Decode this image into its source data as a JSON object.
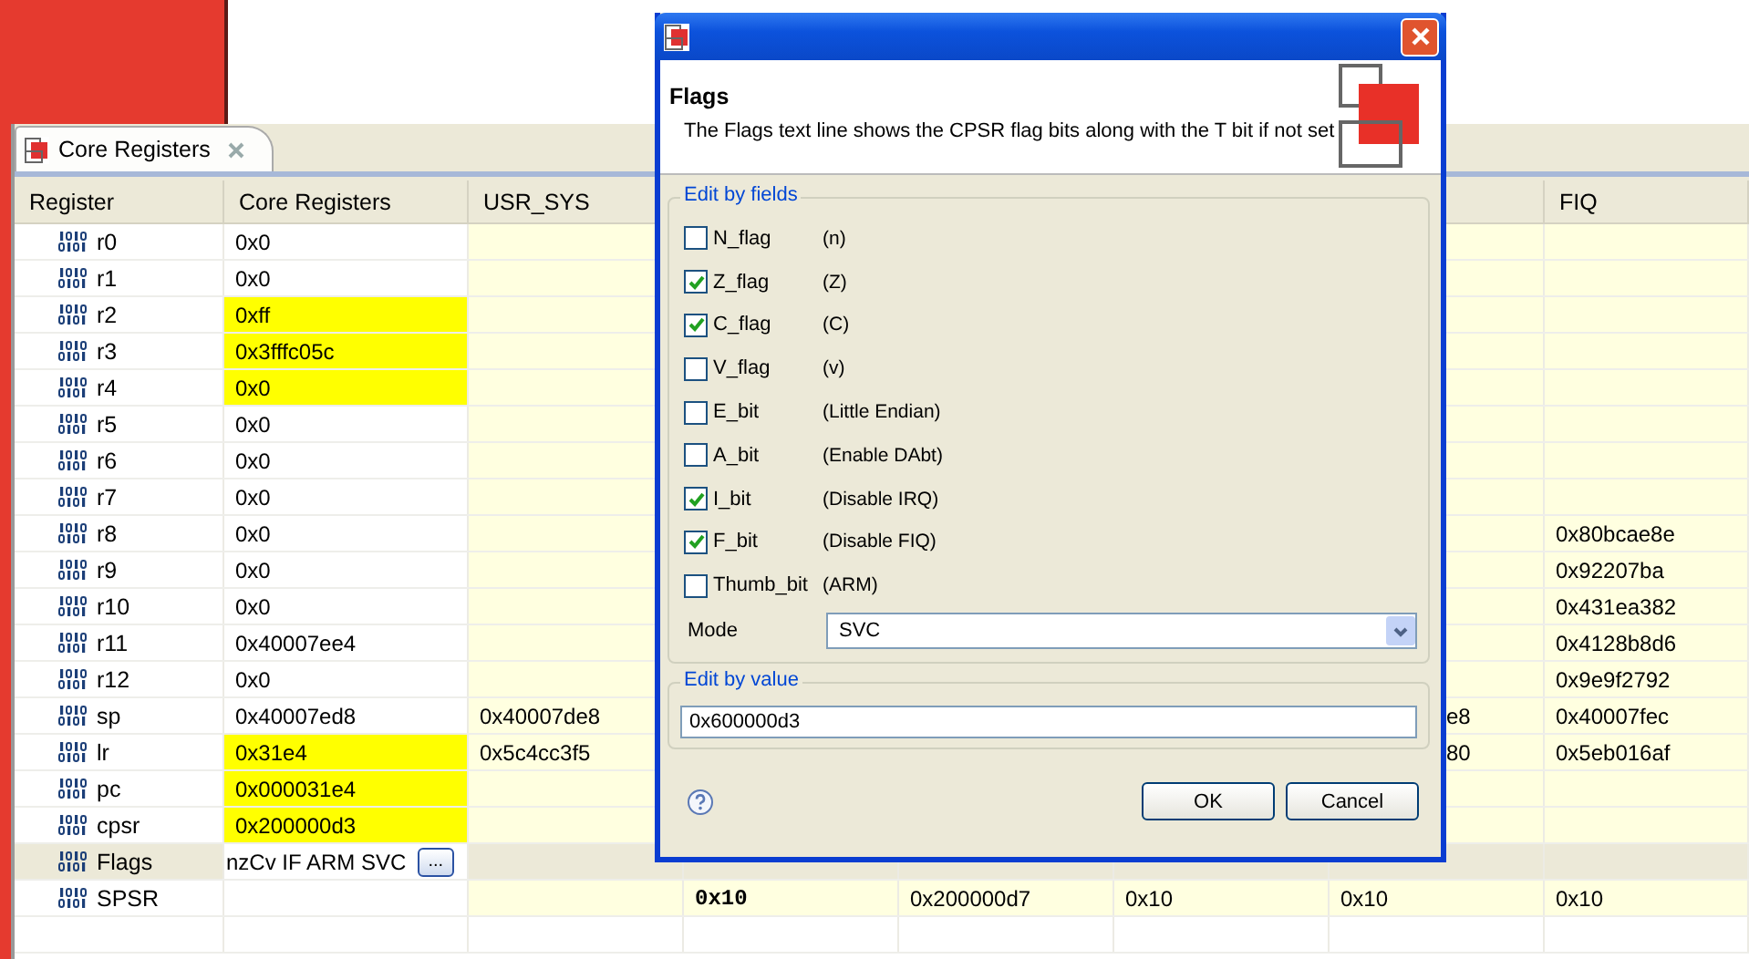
{
  "view_tab": {
    "label": "Core Registers",
    "selected": true
  },
  "table": {
    "headers": [
      "Register",
      "Core Registers",
      "USR_SYS",
      "FIQ"
    ],
    "rows": [
      {
        "kind": "register",
        "register": "r0",
        "core": {
          "text": "0x0",
          "changed": false
        }
      },
      {
        "kind": "register",
        "register": "r1",
        "core": {
          "text": "0x0",
          "changed": false
        }
      },
      {
        "kind": "register",
        "register": "r2",
        "core": {
          "text": "0xff",
          "changed": true
        }
      },
      {
        "kind": "register",
        "register": "r3",
        "core": {
          "text": "0x3fffc05c",
          "changed": true
        }
      },
      {
        "kind": "register",
        "register": "r4",
        "core": {
          "text": "0x0",
          "changed": true
        }
      },
      {
        "kind": "register",
        "register": "r5",
        "core": {
          "text": "0x0",
          "changed": false
        }
      },
      {
        "kind": "register",
        "register": "r6",
        "core": {
          "text": "0x0",
          "changed": false
        }
      },
      {
        "kind": "register",
        "register": "r7",
        "core": {
          "text": "0x0",
          "changed": false
        }
      },
      {
        "kind": "register",
        "register": "r8",
        "core": {
          "text": "0x0",
          "changed": false
        },
        "fiq": "0x80bcae8e"
      },
      {
        "kind": "register",
        "register": "r9",
        "core": {
          "text": "0x0",
          "changed": false
        },
        "fiq": "0x92207ba"
      },
      {
        "kind": "register",
        "register": "r10",
        "core": {
          "text": "0x0",
          "changed": false
        },
        "fiq": "0x431ea382"
      },
      {
        "kind": "register",
        "register": "r11",
        "core": {
          "text": "0x40007ee4",
          "changed": false
        },
        "fiq": "0x4128b8d6"
      },
      {
        "kind": "register",
        "register": "r12",
        "core": {
          "text": "0x0",
          "changed": false
        },
        "fiq": "0x9e9f2792"
      },
      {
        "kind": "register",
        "register": "sp",
        "core": {
          "text": "0x40007ed8",
          "changed": false
        },
        "usr_sys": "0x40007de8",
        "column_7": "e8",
        "fiq": "0x40007fec"
      },
      {
        "kind": "register",
        "register": "lr",
        "core": {
          "text": "0x31e4",
          "changed": true
        },
        "usr_sys": "0x5c4cc3f5",
        "column_7": "80",
        "fiq": "0x5eb016af"
      },
      {
        "kind": "register",
        "register": "pc",
        "core": {
          "text": "0x000031e4",
          "changed": true
        }
      },
      {
        "kind": "register",
        "register": "cpsr",
        "core": {
          "text": "0x200000d3",
          "changed": true
        }
      },
      {
        "kind": "flags",
        "register": "Flags",
        "value": "nzCv IF ARM SVC",
        "edit_button": "..."
      },
      {
        "kind": "register",
        "register": "SPSR",
        "column_4": {
          "text": "0x10",
          "bold": true
        },
        "column_5": "0x200000d7",
        "column_6": "0x10",
        "column_7": "0x10",
        "fiq": "0x10"
      },
      {
        "kind": "empty"
      }
    ]
  },
  "dialog": {
    "heading": "Flags",
    "description": "The Flags text line shows the CPSR flag bits along with the T bit if not set",
    "fields_group": "Edit by fields",
    "fields": [
      {
        "label": "N_flag",
        "meaning": "(n)",
        "checked": false
      },
      {
        "label": "Z_flag",
        "meaning": "(Z)",
        "checked": true
      },
      {
        "label": "C_flag",
        "meaning": "(C)",
        "checked": true
      },
      {
        "label": "V_flag",
        "meaning": "(v)",
        "checked": false
      },
      {
        "label": "E_bit",
        "meaning": "(Little Endian)",
        "checked": false
      },
      {
        "label": "A_bit",
        "meaning": "(Enable DAbt)",
        "checked": false
      },
      {
        "label": "I_bit",
        "meaning": "(Disable IRQ)",
        "checked": true
      },
      {
        "label": "F_bit",
        "meaning": "(Disable FIQ)",
        "checked": true
      },
      {
        "label": "Thumb_bit",
        "meaning": "(ARM)",
        "checked": false
      }
    ],
    "mode": {
      "label": "Mode",
      "value": "SVC"
    },
    "value_group": "Edit by value",
    "value": "0x600000d3",
    "buttons": [
      "OK",
      "Cancel"
    ]
  }
}
